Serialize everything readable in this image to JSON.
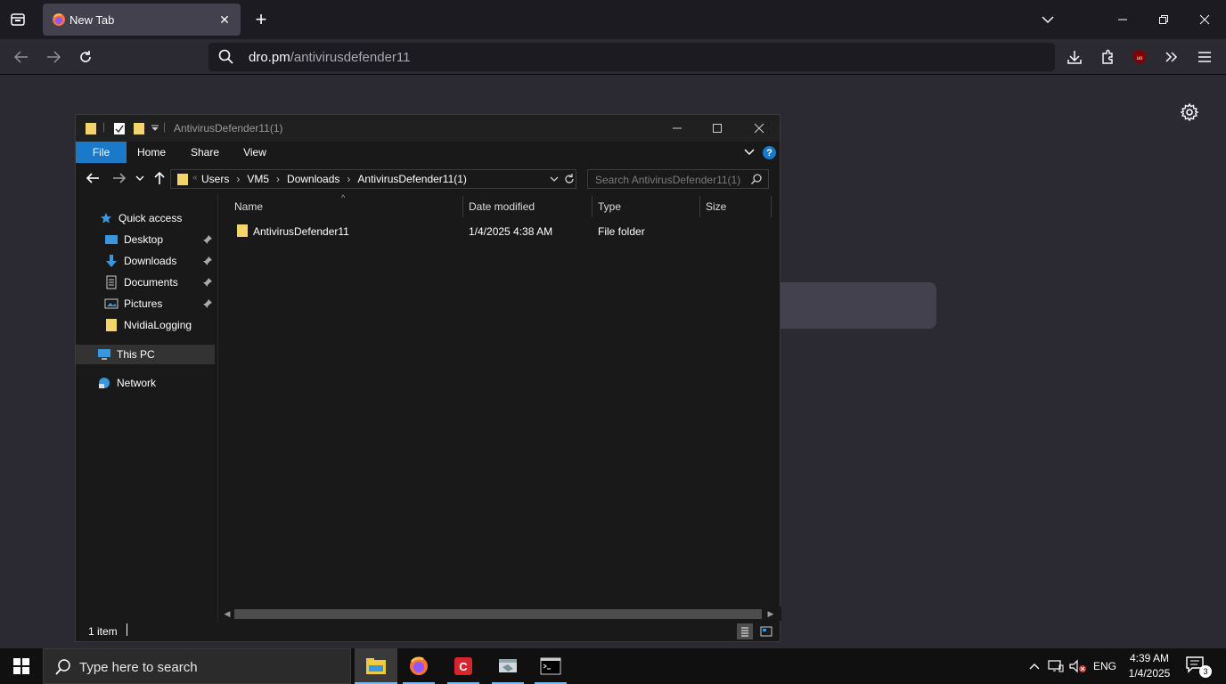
{
  "browser": {
    "tab": {
      "title": "New Tab"
    },
    "url": {
      "host": "dro.pm",
      "path": "/antivirusdefender11"
    }
  },
  "explorer": {
    "title": "AntivirusDefender11(1)",
    "ribbon_tabs": [
      "File",
      "Home",
      "Share",
      "View"
    ],
    "help": "?",
    "breadcrumb": [
      "Users",
      "VM5",
      "Downloads",
      "AntivirusDefender11(1)"
    ],
    "search_placeholder": "Search AntivirusDefender11(1)",
    "nav": {
      "quick_access": "Quick access",
      "items": [
        "Desktop",
        "Downloads",
        "Documents",
        "Pictures",
        "NvidiaLogging"
      ],
      "this_pc": "This PC",
      "network": "Network"
    },
    "columns": [
      "Name",
      "Date modified",
      "Type",
      "Size"
    ],
    "files": [
      {
        "name": "AntivirusDefender11",
        "date": "1/4/2025 4:38 AM",
        "type": "File folder",
        "size": ""
      }
    ],
    "status": "1 item"
  },
  "taskbar": {
    "search_text": "Type here to search",
    "lang": "ENG",
    "time": "4:39 AM",
    "date": "1/4/2025",
    "notifications": "3"
  },
  "colors": {
    "accent": "#1979ca",
    "folder": "#f5d46b",
    "firefox_bg": "#2b2a33"
  }
}
